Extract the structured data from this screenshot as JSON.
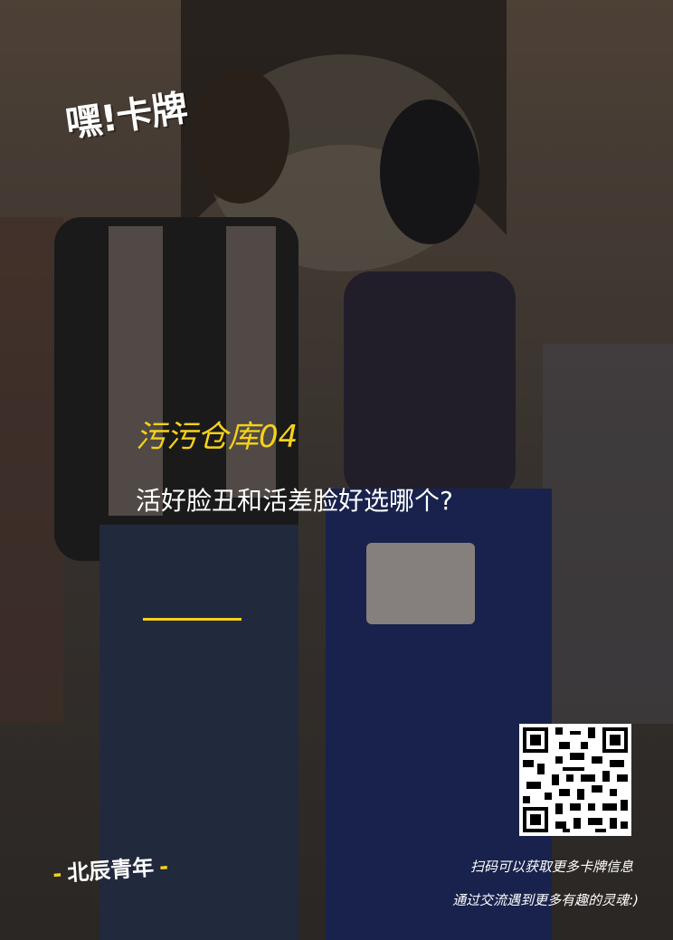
{
  "brand": {
    "logo": "嘿!卡牌"
  },
  "card": {
    "title": "污污仓库04",
    "question": "活好脸丑和活差脸好选哪个?"
  },
  "footer": {
    "org": "北辰青年",
    "dash": "-",
    "scan_line1": "扫码可以获取更多卡牌信息",
    "scan_line2": "通过交流遇到更多有趣的灵魂:)"
  },
  "colors": {
    "accent": "#f5d21a",
    "text": "#ffffff"
  }
}
